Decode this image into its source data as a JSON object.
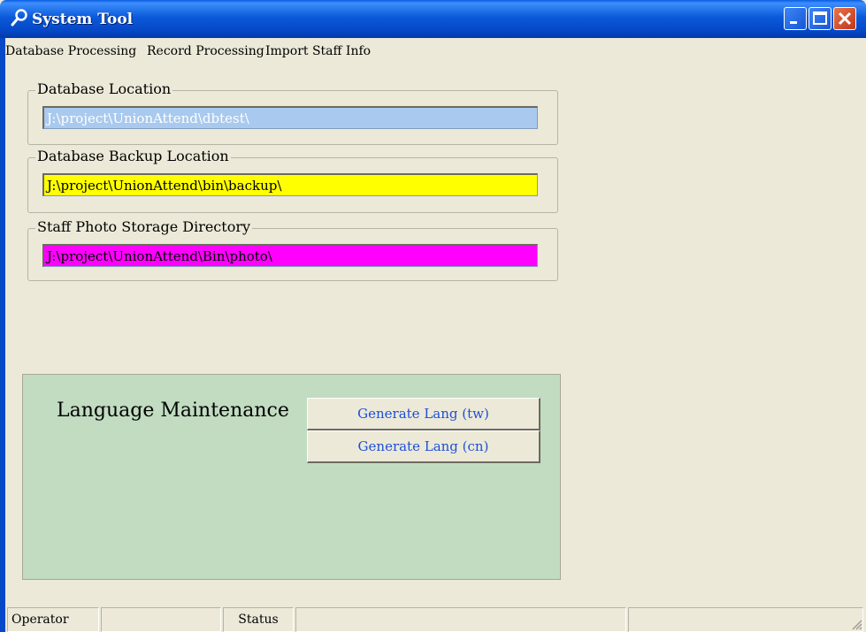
{
  "window": {
    "title": "System Tool",
    "title_icon": "wrench-icon",
    "title_bar_color": "#0548c8"
  },
  "menu": {
    "items": [
      "Database Processing",
      "Record Processing",
      "Import Staff Info"
    ]
  },
  "groups": {
    "db_location": {
      "label": "Database Location",
      "value": "J:\\project\\UnionAttend\\dbtest\\",
      "color": "#a9c9ee"
    },
    "db_backup": {
      "label": "Database Backup Location",
      "value": "J:\\project\\UnionAttend\\bin\\backup\\",
      "color": "#ffff00"
    },
    "photo_dir": {
      "label": "Staff Photo Storage Directory",
      "value": "J:\\project\\UnionAttend\\Bin\\photo\\",
      "color": "#ff00ff"
    }
  },
  "language": {
    "title": "Language Maintenance",
    "panel_color": "#c1dcc1",
    "buttons": [
      "Generate Lang (tw)",
      "Generate Lang (cn)"
    ]
  },
  "statusbar": {
    "operator_label": "Operator",
    "operator_value": "",
    "status_label": "Status",
    "status_value": "",
    "extra_value": ""
  }
}
